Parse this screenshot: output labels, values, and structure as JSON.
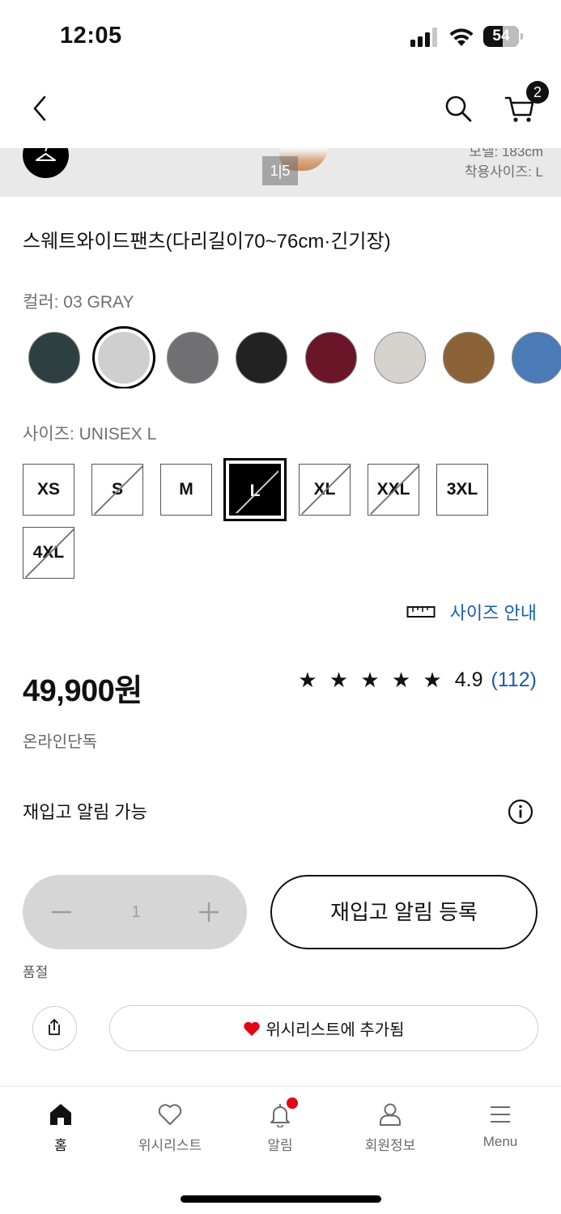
{
  "status_bar": {
    "time": "12:05",
    "battery_level": "54",
    "battery_fraction": 0.54,
    "icons": [
      "signal-icon",
      "wifi-icon",
      "battery-icon"
    ]
  },
  "header": {
    "back_icon": "chevron-left-icon",
    "search_icon": "search-icon",
    "cart_icon": "cart-icon",
    "cart_count": "2"
  },
  "gallery": {
    "counter": "1|5",
    "model_height": "모델: 183cm",
    "model_size": "착용사이즈: L",
    "hanger_icon": "hanger-icon"
  },
  "product": {
    "title": "스웨트와이드팬츠(다리길이70~76cm·긴기장)",
    "color_label": "컬러: 03 GRAY",
    "size_label": "사이즈: UNISEX L",
    "price": "49,900원",
    "online_tag": "온라인단독",
    "rating_stars": "★ ★ ★ ★ ★",
    "rating_value_num": 4.9,
    "rating_value": "4.9",
    "review_count": "(112)",
    "restock_info": "재입고 알림 가능",
    "soldout_label": "품절"
  },
  "colors": [
    {
      "name": "dark-green",
      "hex": "#2e3f41",
      "selected": false
    },
    {
      "name": "light-gray",
      "hex": "#cfcfd0",
      "selected": true
    },
    {
      "name": "gray",
      "hex": "#707073",
      "selected": false
    },
    {
      "name": "black",
      "hex": "#222222",
      "selected": false
    },
    {
      "name": "wine",
      "hex": "#6b1529",
      "selected": false
    },
    {
      "name": "beige",
      "hex": "#d6d2cd",
      "selected": false
    },
    {
      "name": "brown",
      "hex": "#8c6338",
      "selected": false
    },
    {
      "name": "blue",
      "hex": "#4a7bb6",
      "selected": false
    }
  ],
  "sizes": [
    {
      "label": "XS",
      "soldout": false,
      "selected": false
    },
    {
      "label": "S",
      "soldout": true,
      "selected": false
    },
    {
      "label": "M",
      "soldout": false,
      "selected": false
    },
    {
      "label": "L",
      "soldout": true,
      "selected": true
    },
    {
      "label": "XL",
      "soldout": true,
      "selected": false
    },
    {
      "label": "XXL",
      "soldout": true,
      "selected": false
    },
    {
      "label": "3XL",
      "soldout": false,
      "selected": false
    },
    {
      "label": "4XL",
      "soldout": true,
      "selected": false
    }
  ],
  "size_guide": {
    "label": "사이즈 안내",
    "icon": "ruler-icon"
  },
  "quantity": {
    "value": "1",
    "minus_icon": "minus-icon",
    "plus_icon": "plus-icon"
  },
  "actions": {
    "restock_button": "재입고 알림 등록",
    "wishlist_button": "위시리스트에 추가됨",
    "share_icon": "share-icon",
    "heart_color": "#e30613"
  },
  "tabs": [
    {
      "label": "홈",
      "icon": "home-icon",
      "active": true
    },
    {
      "label": "위시리스트",
      "icon": "heart-icon",
      "active": false
    },
    {
      "label": "알림",
      "icon": "bell-icon",
      "active": false
    },
    {
      "label": "회원정보",
      "icon": "user-icon",
      "active": false
    },
    {
      "label": "Menu",
      "icon": "menu-icon",
      "active": false
    }
  ],
  "colors_ui": {
    "link_blue": "#1a5ea8",
    "notification_dot": "#e30613"
  }
}
